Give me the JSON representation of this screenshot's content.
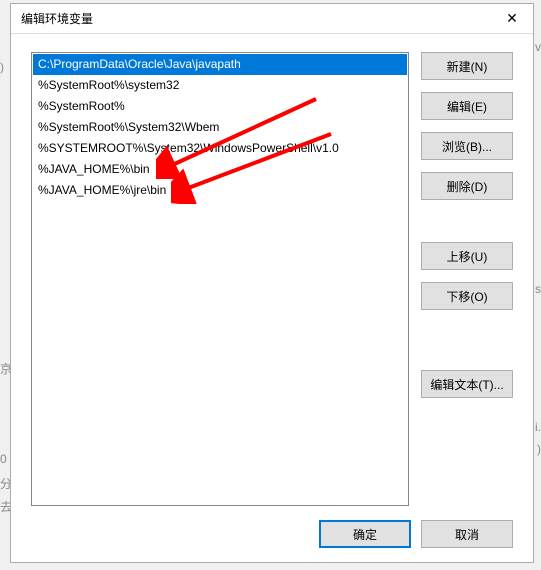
{
  "window": {
    "title": "编辑环境变量",
    "close_glyph": "✕"
  },
  "list": {
    "items": [
      "C:\\ProgramData\\Oracle\\Java\\javapath",
      "%SystemRoot%\\system32",
      "%SystemRoot%",
      "%SystemRoot%\\System32\\Wbem",
      "%SYSTEMROOT%\\System32\\WindowsPowerShell\\v1.0",
      "%JAVA_HOME%\\bin",
      "%JAVA_HOME%\\jre\\bin"
    ],
    "selected_index": 0
  },
  "buttons": {
    "new": "新建(N)",
    "edit": "编辑(E)",
    "browse": "浏览(B)...",
    "delete": "删除(D)",
    "move_up": "上移(U)",
    "move_down": "下移(O)",
    "edit_text": "编辑文本(T)...",
    "ok": "确定",
    "cancel": "取消"
  },
  "annotations": {
    "arrow_color": "#ff0000"
  }
}
